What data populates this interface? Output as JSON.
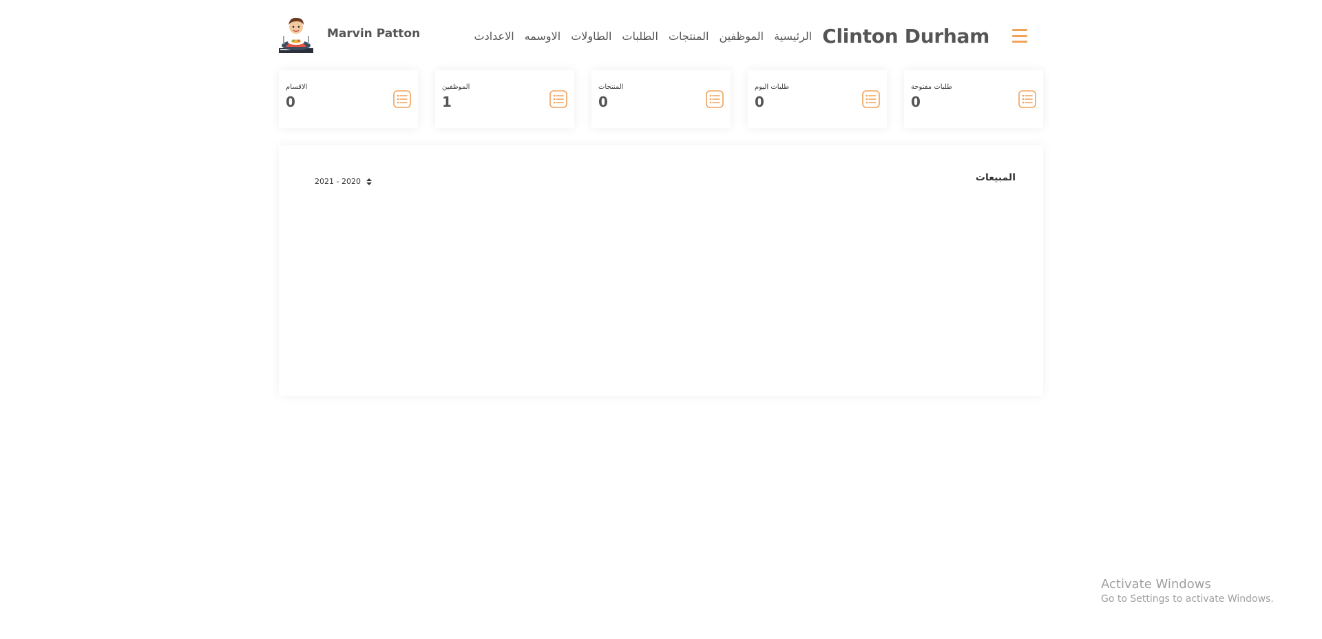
{
  "header": {
    "user_name": "Marvin Patton",
    "brand": "Clinton Durham",
    "menu_icon": "hamburger-icon",
    "nav": [
      {
        "label": "الرئيسية"
      },
      {
        "label": "الموظفين"
      },
      {
        "label": "المنتجات"
      },
      {
        "label": "الطلبات"
      },
      {
        "label": "الطاولات"
      },
      {
        "label": "الاوسمه"
      },
      {
        "label": "الاعدادت"
      }
    ]
  },
  "stats": [
    {
      "label": "الاقسام",
      "value": "0",
      "icon": "list-icon"
    },
    {
      "label": "الموظفين",
      "value": "1",
      "icon": "list-icon"
    },
    {
      "label": "المنتجات",
      "value": "0",
      "icon": "list-icon"
    },
    {
      "label": "طلبات اليوم",
      "value": "0",
      "icon": "list-icon"
    },
    {
      "label": "طلبات مفتوحة",
      "value": "0",
      "icon": "list-icon"
    }
  ],
  "sales": {
    "title": "المبيعات",
    "year_selected": "2021 - 2020"
  },
  "watermark": {
    "line1": "Activate Windows",
    "line2": "Go to Settings to activate Windows."
  },
  "colors": {
    "accent": "#f0a25a",
    "text": "#555555"
  }
}
